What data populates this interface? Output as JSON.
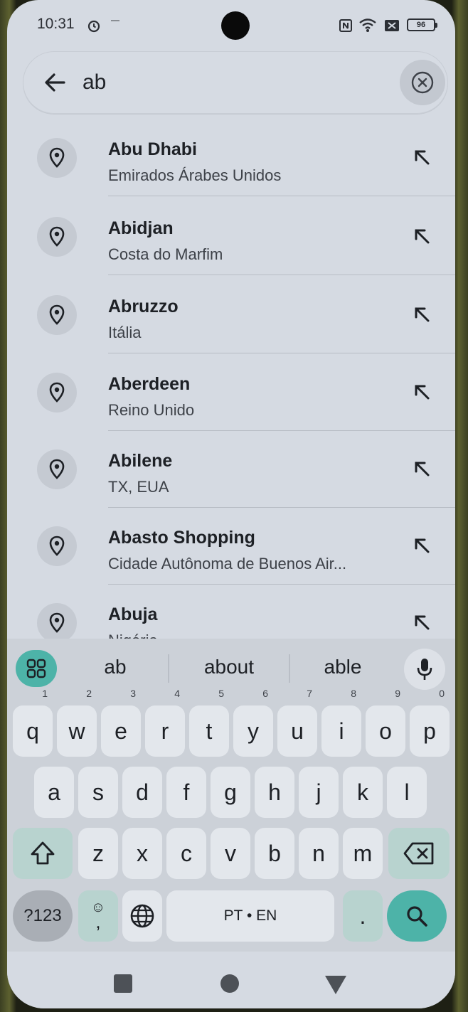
{
  "status_bar": {
    "time": "10:31",
    "battery": "96",
    "icons": [
      "alarm-icon",
      "nfc-icon",
      "wifi-icon",
      "signal-icon"
    ]
  },
  "search": {
    "query": "ab",
    "back_icon": "arrow-left-icon",
    "clear_icon": "close-circle-icon"
  },
  "results": [
    {
      "name": "Abu Dhabi",
      "subtitle": "Emirados Árabes Unidos"
    },
    {
      "name": "Abidjan",
      "subtitle": "Costa do Marfim"
    },
    {
      "name": "Abruzzo",
      "subtitle": "Itália"
    },
    {
      "name": "Aberdeen",
      "subtitle": "Reino Unido"
    },
    {
      "name": "Abilene",
      "subtitle": "TX, EUA"
    },
    {
      "name": "Abasto Shopping",
      "subtitle": "Cidade Autônoma de Buenos Air..."
    },
    {
      "name": "Abuja",
      "subtitle": "Nigéria"
    }
  ],
  "keyboard": {
    "suggestions": [
      "ab",
      "about",
      "able"
    ],
    "row1": [
      "q",
      "w",
      "e",
      "r",
      "t",
      "y",
      "u",
      "i",
      "o",
      "p"
    ],
    "row1_hints": [
      "1",
      "2",
      "3",
      "4",
      "5",
      "6",
      "7",
      "8",
      "9",
      "0"
    ],
    "row2": [
      "a",
      "s",
      "d",
      "f",
      "g",
      "h",
      "j",
      "k",
      "l"
    ],
    "row3": [
      "z",
      "x",
      "c",
      "v",
      "b",
      "n",
      "m"
    ],
    "symbols_label": "?123",
    "emoji_comma": ",",
    "space_label": "PT • EN",
    "period": ".",
    "accent_color": "#4db3a8"
  },
  "nav_bar": {
    "icons": [
      "recents-square-icon",
      "home-circle-icon",
      "back-triangle-icon"
    ]
  }
}
